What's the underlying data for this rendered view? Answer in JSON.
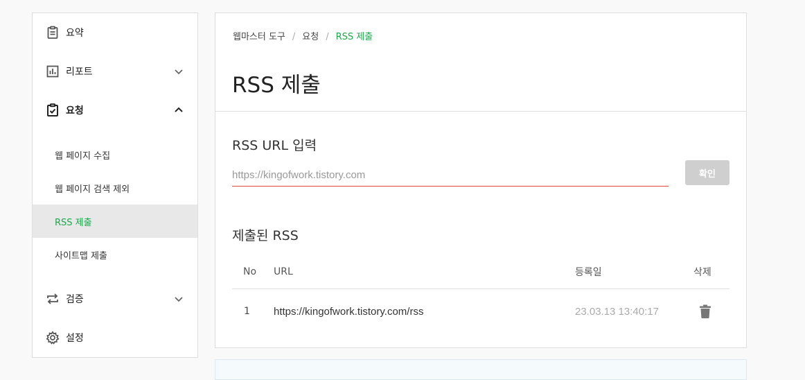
{
  "sidebar": {
    "summary": {
      "label": "요약",
      "icon": "clipboard-icon"
    },
    "report": {
      "label": "리포트",
      "icon": "bar-chart-icon"
    },
    "request": {
      "label": "요청",
      "icon": "clipboard-check-icon"
    },
    "request_items": [
      "웹 페이지 수집",
      "웹 페이지 검색 제외",
      "RSS 제출",
      "사이트맵 제출"
    ],
    "active_item": "RSS 제출",
    "verify": {
      "label": "검증",
      "icon": "repeat-icon"
    },
    "settings": {
      "label": "설정",
      "icon": "gear-icon"
    }
  },
  "breadcrumb": [
    "웹마스터 도구",
    "요청",
    "RSS 제출"
  ],
  "page_title": "RSS 제출",
  "rss_input": {
    "title": "RSS URL 입력",
    "placeholder": "https://kingofwork.tistory.com",
    "value": "",
    "button_label": "확인"
  },
  "submitted": {
    "title": "제출된 RSS",
    "columns": [
      "No",
      "URL",
      "등록일",
      "삭제"
    ],
    "rows": [
      {
        "no": "1",
        "url": "https://kingofwork.tistory.com/rss",
        "date": "23.03.13 13:40:17",
        "delete_icon": "trash-icon"
      }
    ]
  },
  "colors": {
    "accent": "#19a84a",
    "input_underline": "#e0443a",
    "button_disabled": "#cfcfcf"
  }
}
